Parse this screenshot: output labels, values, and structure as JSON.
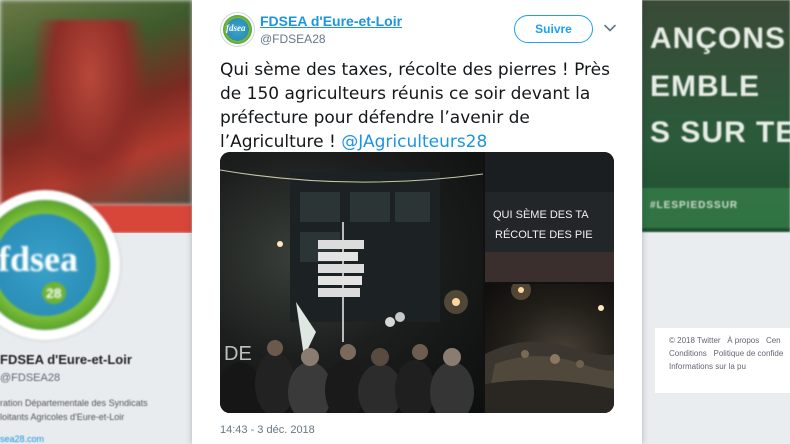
{
  "background": {
    "left_profile": {
      "logo_text": "fdsea",
      "logo_number": "28",
      "name": "FDSEA d'Eure-et-Loir",
      "handle": "@FDSEA28",
      "description_line1": "ration Départementale des Syndicats",
      "description_line2": "loitants Agricoles d'Eure-et-Loir",
      "link": "sea28.com"
    },
    "right_banner": {
      "line1": "ANÇONS",
      "line2": "EMBLE",
      "line3": "S SUR TE",
      "hashtag": "#LESPIEDSSUR"
    },
    "footer": {
      "line1_a": "© 2018 Twitter",
      "line1_b": "À propos",
      "line1_c": "Cen",
      "line2_a": "Conditions",
      "line2_b": "Politique de confide",
      "line3": "Informations sur la pu"
    }
  },
  "tweet": {
    "author_name": "FDSEA d'Eure-et-Loir",
    "author_handle": "@FDSEA28",
    "avatar_text": "fdsea",
    "follow_label": "Suivre",
    "text": "Qui sème des taxes, récolte des pierres ! Près de 150 agriculteurs réunis ce soir devant la préfecture pour défendre l’avenir de l’Agriculture ! ",
    "mention": "@JAgriculteurs28",
    "timestamp": "14:43 - 3 déc. 2018",
    "photos": {
      "main_signs": [
        "",
        "Prefecture",
        "Centre",
        "Bus Terminaux",
        "Gare SNCF",
        "Bus Routiers"
      ],
      "tr_graffiti_line1": "QUI SÈME DES TA",
      "tr_graffiti_line2": "RÉCOLTE DES PIE"
    }
  },
  "colors": {
    "link_blue": "#1b95e0",
    "follow_blue": "#1da1f2",
    "text": "#14171a",
    "muted": "#657786"
  }
}
